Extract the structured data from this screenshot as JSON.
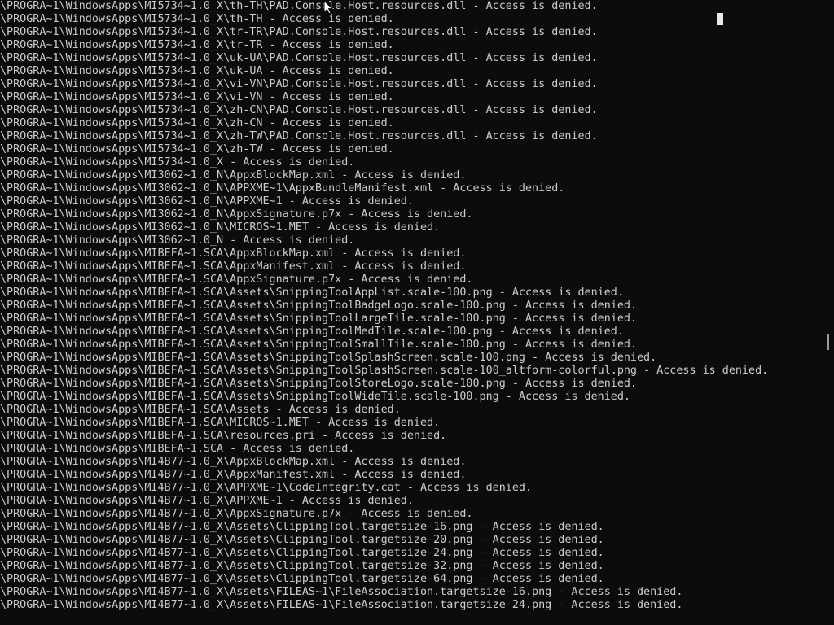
{
  "console": {
    "lines": [
      "\\PROGRA~1\\WindowsApps\\MI5734~1.0_X\\th-TH\\PAD.Console.Host.resources.dll - Access is denied.",
      "\\PROGRA~1\\WindowsApps\\MI5734~1.0_X\\th-TH - Access is denied.",
      "\\PROGRA~1\\WindowsApps\\MI5734~1.0_X\\tr-TR\\PAD.Console.Host.resources.dll - Access is denied.",
      "\\PROGRA~1\\WindowsApps\\MI5734~1.0_X\\tr-TR - Access is denied.",
      "\\PROGRA~1\\WindowsApps\\MI5734~1.0_X\\uk-UA\\PAD.Console.Host.resources.dll - Access is denied.",
      "\\PROGRA~1\\WindowsApps\\MI5734~1.0_X\\uk-UA - Access is denied.",
      "\\PROGRA~1\\WindowsApps\\MI5734~1.0_X\\vi-VN\\PAD.Console.Host.resources.dll - Access is denied.",
      "\\PROGRA~1\\WindowsApps\\MI5734~1.0_X\\vi-VN - Access is denied.",
      "\\PROGRA~1\\WindowsApps\\MI5734~1.0_X\\zh-CN\\PAD.Console.Host.resources.dll - Access is denied.",
      "\\PROGRA~1\\WindowsApps\\MI5734~1.0_X\\zh-CN - Access is denied.",
      "\\PROGRA~1\\WindowsApps\\MI5734~1.0_X\\zh-TW\\PAD.Console.Host.resources.dll - Access is denied.",
      "\\PROGRA~1\\WindowsApps\\MI5734~1.0_X\\zh-TW - Access is denied.",
      "\\PROGRA~1\\WindowsApps\\MI5734~1.0_X - Access is denied.",
      "\\PROGRA~1\\WindowsApps\\MI3062~1.0_N\\AppxBlockMap.xml - Access is denied.",
      "\\PROGRA~1\\WindowsApps\\MI3062~1.0_N\\APPXME~1\\AppxBundleManifest.xml - Access is denied.",
      "\\PROGRA~1\\WindowsApps\\MI3062~1.0_N\\APPXME~1 - Access is denied.",
      "\\PROGRA~1\\WindowsApps\\MI3062~1.0_N\\AppxSignature.p7x - Access is denied.",
      "\\PROGRA~1\\WindowsApps\\MI3062~1.0_N\\MICROS~1.MET - Access is denied.",
      "\\PROGRA~1\\WindowsApps\\MI3062~1.0_N - Access is denied.",
      "\\PROGRA~1\\WindowsApps\\MIBEFA~1.SCA\\AppxBlockMap.xml - Access is denied.",
      "\\PROGRA~1\\WindowsApps\\MIBEFA~1.SCA\\AppxManifest.xml - Access is denied.",
      "\\PROGRA~1\\WindowsApps\\MIBEFA~1.SCA\\AppxSignature.p7x - Access is denied.",
      "\\PROGRA~1\\WindowsApps\\MIBEFA~1.SCA\\Assets\\SnippingToolAppList.scale-100.png - Access is denied.",
      "\\PROGRA~1\\WindowsApps\\MIBEFA~1.SCA\\Assets\\SnippingToolBadgeLogo.scale-100.png - Access is denied.",
      "\\PROGRA~1\\WindowsApps\\MIBEFA~1.SCA\\Assets\\SnippingToolLargeTile.scale-100.png - Access is denied.",
      "\\PROGRA~1\\WindowsApps\\MIBEFA~1.SCA\\Assets\\SnippingToolMedTile.scale-100.png - Access is denied.",
      "\\PROGRA~1\\WindowsApps\\MIBEFA~1.SCA\\Assets\\SnippingToolSmallTile.scale-100.png - Access is denied.",
      "\\PROGRA~1\\WindowsApps\\MIBEFA~1.SCA\\Assets\\SnippingToolSplashScreen.scale-100.png - Access is denied.",
      "\\PROGRA~1\\WindowsApps\\MIBEFA~1.SCA\\Assets\\SnippingToolSplashScreen.scale-100_altform-colorful.png - Access is denied.",
      "\\PROGRA~1\\WindowsApps\\MIBEFA~1.SCA\\Assets\\SnippingToolStoreLogo.scale-100.png - Access is denied.",
      "\\PROGRA~1\\WindowsApps\\MIBEFA~1.SCA\\Assets\\SnippingToolWideTile.scale-100.png - Access is denied.",
      "\\PROGRA~1\\WindowsApps\\MIBEFA~1.SCA\\Assets - Access is denied.",
      "\\PROGRA~1\\WindowsApps\\MIBEFA~1.SCA\\MICROS~1.MET - Access is denied.",
      "\\PROGRA~1\\WindowsApps\\MIBEFA~1.SCA\\resources.pri - Access is denied.",
      "\\PROGRA~1\\WindowsApps\\MIBEFA~1.SCA - Access is denied.",
      "\\PROGRA~1\\WindowsApps\\MI4B77~1.0_X\\AppxBlockMap.xml - Access is denied.",
      "\\PROGRA~1\\WindowsApps\\MI4B77~1.0_X\\AppxManifest.xml - Access is denied.",
      "\\PROGRA~1\\WindowsApps\\MI4B77~1.0_X\\APPXME~1\\CodeIntegrity.cat - Access is denied.",
      "\\PROGRA~1\\WindowsApps\\MI4B77~1.0_X\\APPXME~1 - Access is denied.",
      "\\PROGRA~1\\WindowsApps\\MI4B77~1.0_X\\AppxSignature.p7x - Access is denied.",
      "\\PROGRA~1\\WindowsApps\\MI4B77~1.0_X\\Assets\\ClippingTool.targetsize-16.png - Access is denied.",
      "\\PROGRA~1\\WindowsApps\\MI4B77~1.0_X\\Assets\\ClippingTool.targetsize-20.png - Access is denied.",
      "\\PROGRA~1\\WindowsApps\\MI4B77~1.0_X\\Assets\\ClippingTool.targetsize-24.png - Access is denied.",
      "\\PROGRA~1\\WindowsApps\\MI4B77~1.0_X\\Assets\\ClippingTool.targetsize-32.png - Access is denied.",
      "\\PROGRA~1\\WindowsApps\\MI4B77~1.0_X\\Assets\\ClippingTool.targetsize-64.png - Access is denied.",
      "\\PROGRA~1\\WindowsApps\\MI4B77~1.0_X\\Assets\\FILEAS~1\\FileAssociation.targetsize-16.png - Access is denied.",
      "\\PROGRA~1\\WindowsApps\\MI4B77~1.0_X\\Assets\\FILEAS~1\\FileAssociation.targetsize-24.png - Access is denied."
    ]
  },
  "colors": {
    "background": "#0c0c0c",
    "text": "#cccccc"
  },
  "icons": {
    "pointer": "mouse-pointer-icon"
  }
}
